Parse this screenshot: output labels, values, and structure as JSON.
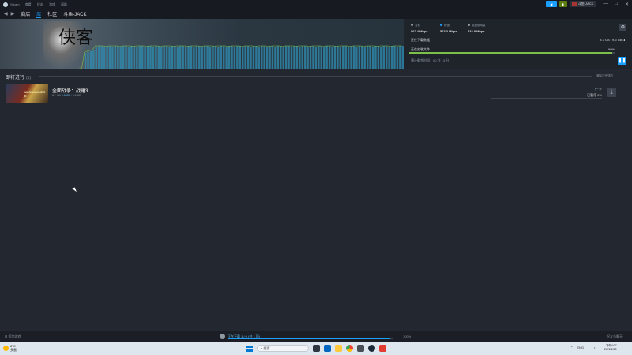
{
  "titlebar": {
    "menu": [
      "Steam",
      "查看",
      "好友",
      "游戏",
      "帮助"
    ],
    "user": "斗鱼-JACK",
    "controls": [
      "—",
      "□",
      "✕"
    ]
  },
  "nav": {
    "items": [
      "商店",
      "库",
      "社区",
      "斗鱼-JACK"
    ]
  },
  "banner": {
    "calligraphy": "侠客"
  },
  "stats": {
    "current": {
      "label": "当前",
      "value": "567.4 Mbps"
    },
    "peak": {
      "label": "峰值",
      "value": "573.3 Mbps"
    },
    "disk": {
      "label": "磁盘使用量",
      "value": "832.8 Mbps"
    },
    "downloading_label": "正在下载数据",
    "downloading_value": "8.7 GB / 9.6 GB",
    "verifying_label": "正在安装文件",
    "verifying_pct": "99%",
    "remaining": "预计剩余时间：00 秒 13 分"
  },
  "section": {
    "title": "即将进行",
    "count": "(1)",
    "clear_label": "清除已完成的"
  },
  "item": {
    "title": "全面战争：战锤3",
    "thumb_text": "WARHAMMER III",
    "sub_prefix": "8.7 GB",
    "sub_highlight": "9.6 GB",
    "sub_suffix": "/ 8.6 GB",
    "right_label": "下一步",
    "pct_label": "已暂停 0%"
  },
  "statusbar": {
    "add_game": "添加游戏",
    "manage": "正在下载 1 / 0 (共 1 项)",
    "pct": "100%",
    "friends": "好友与聊天"
  },
  "taskbar": {
    "weather_temp": "8°C",
    "weather_desc": "多云",
    "search": "搜索",
    "lang": "ENG",
    "time": "下午4:07",
    "date": "2022/2/20"
  },
  "progress": {
    "download": 0.9,
    "install": 0.99,
    "manager": 0.98
  },
  "colors": {
    "accent": "#1a9fff",
    "success": "#7cc04a",
    "bg": "#23272f"
  }
}
